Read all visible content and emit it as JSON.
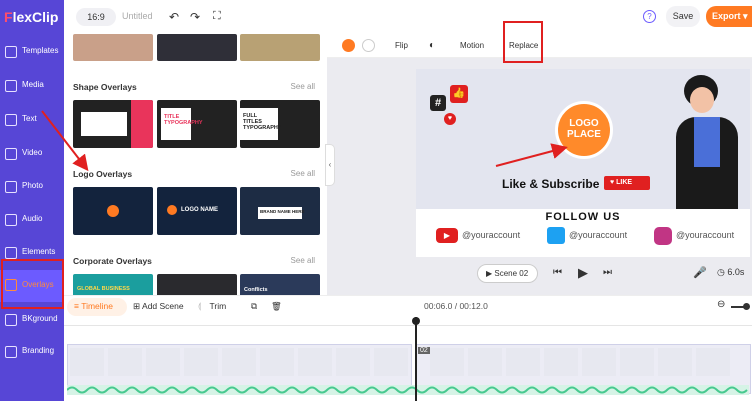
{
  "app": {
    "name": "FlexClip",
    "logo_letter": "F",
    "logo_rest": "lexClip"
  },
  "sidebar": {
    "items": [
      {
        "label": "Templates",
        "icon": "templates-icon"
      },
      {
        "label": "Media",
        "icon": "media-icon"
      },
      {
        "label": "Text",
        "icon": "text-icon"
      },
      {
        "label": "Video",
        "icon": "video-icon"
      },
      {
        "label": "Photo",
        "icon": "photo-icon"
      },
      {
        "label": "Audio",
        "icon": "audio-icon"
      },
      {
        "label": "Elements",
        "icon": "elements-icon"
      },
      {
        "label": "Overlays",
        "icon": "overlays-icon",
        "active": true
      },
      {
        "label": "BKground",
        "icon": "background-icon"
      },
      {
        "label": "Branding",
        "icon": "branding-icon"
      }
    ]
  },
  "topbar": {
    "ratio": "16:9",
    "title": "Untitled",
    "help": "?",
    "save": "Save",
    "export": "Export"
  },
  "panel": {
    "sections": [
      {
        "title": "Shape Overlays",
        "see_all": "See all"
      },
      {
        "title": "Logo Overlays",
        "see_all": "See all"
      },
      {
        "title": "Corporate Overlays",
        "see_all": "See all"
      }
    ],
    "shape_thumbs": [
      "TITLE TYPOGRAPHY",
      "FULL TITLES TYPOGRAPHY"
    ],
    "logo_thumbs": [
      "LOGO NAME",
      "BRAND NAME HERE"
    ],
    "corporate_thumbs": [
      "GLOBAL BUSINESS",
      "Conflicts"
    ]
  },
  "options": {
    "flip": "Flip",
    "motion": "Motion",
    "replace": "Replace"
  },
  "preview": {
    "logo_line1": "LOGO",
    "logo_line2": "PLACE",
    "like_subscribe": "Like & Subscribe",
    "like": "LIKE",
    "follow_us": "FOLLOW US",
    "accounts": [
      "@youraccount",
      "@youraccount",
      "@youraccount"
    ],
    "hash": "#"
  },
  "playback": {
    "scene": "Scene 02",
    "duration": "6.0s"
  },
  "timeline": {
    "tab": "Timeline",
    "add_scene": "Add Scene",
    "trim": "Trim",
    "time": "00:06.0 / 00:12.0",
    "clip2_index": "02"
  },
  "colors": {
    "brand": "#5746d6",
    "accent": "#ff7a22",
    "highlight": "#e02020"
  }
}
